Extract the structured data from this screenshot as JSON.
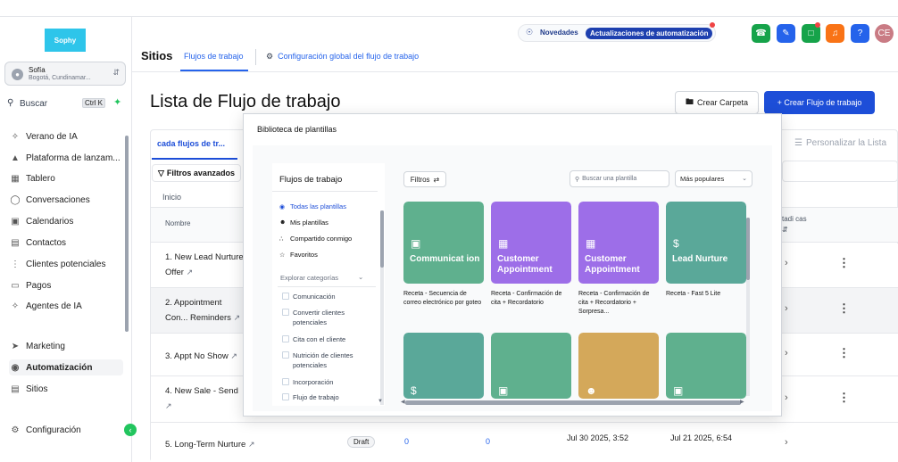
{
  "brand": {
    "logo_text": "Sophy",
    "accent": "#2563eb"
  },
  "location": {
    "name": "Sofía",
    "address": "Bogotá, Cundinamar..."
  },
  "search": {
    "label": "Buscar",
    "shortcut": "Ctrl K"
  },
  "nav": [
    {
      "label": "Verano de IA",
      "icon": "sparkle-icon"
    },
    {
      "label": "Plataforma de lanzam...",
      "icon": "rocket-icon"
    },
    {
      "label": "Tablero",
      "icon": "dashboard-icon"
    },
    {
      "label": "Conversaciones",
      "icon": "chat-icon"
    },
    {
      "label": "Calendarios",
      "icon": "calendar-icon"
    },
    {
      "label": "Contactos",
      "icon": "contacts-icon"
    },
    {
      "label": "Clientes potenciales",
      "icon": "funnel-icon"
    },
    {
      "label": "Pagos",
      "icon": "payments-icon"
    },
    {
      "label": "Agentes de IA",
      "icon": "sparkle-icon"
    },
    {
      "label": "Marketing",
      "icon": "send-icon"
    },
    {
      "label": "Automatización",
      "icon": "automation-icon"
    },
    {
      "label": "Sitios",
      "icon": "sites-icon"
    },
    {
      "label": "Configuración",
      "icon": "gear-icon"
    }
  ],
  "header": {
    "section": "Sitios",
    "tabs": [
      "Flujos de trabajo",
      "Configuración global del flujo de trabajo"
    ],
    "novedades": "Novedades",
    "update_badge": "Actualizaciones de automatización",
    "user_initials": "CE",
    "help": "?"
  },
  "main": {
    "title": "Lista de Flujo de trabajo",
    "btn_folder": "Crear Carpeta",
    "btn_create": "+ Crear Flujo de trabajo",
    "filter_tab": "cada flujos de tr...",
    "personalize": "Personalizar la Lista",
    "advanced_filters": "Filtros avanzados",
    "breadcrumb": "Inicio",
    "col_name": "Nombre",
    "col_status": "tadi cas",
    "rows": [
      {
        "name": "1. New Lead Nurture Offer"
      },
      {
        "name": "2. Appointment Con... Reminders"
      },
      {
        "name": "3. Appt No Show"
      },
      {
        "name": "4. New Sale - Send"
      },
      {
        "name": "5. Long-Term Nurture",
        "status": "Draft",
        "c1": "0",
        "c2": "0",
        "updated": "Jul 30 2025, 3:52",
        "created": "Jul 21 2025, 6:54"
      }
    ]
  },
  "modal": {
    "title": "Biblioteca de plantillas",
    "left_heading": "Flujos de trabajo",
    "menu": [
      "Todas las plantillas",
      "Mis plantillas",
      "Compartido conmigo",
      "Favoritos"
    ],
    "explore": "Explorar categorías",
    "categories": [
      "Comunicación",
      "Convertir clientes potenciales",
      "Cita con el cliente",
      "Nutrición de clientes potenciales",
      "Incorporación",
      "Flujo de trabajo"
    ],
    "filters_btn": "Filtros",
    "search_placeholder": "Buscar una plantilla",
    "sort": "Más populares",
    "cards": [
      {
        "title": "Communicat ion",
        "desc": "Receta - Secuencia de correo electrónico por goteo",
        "color": "#5fb08e",
        "icon": "chat-icon"
      },
      {
        "title": "Customer Appointment",
        "desc": "Receta - Confirmación de cita + Recordatorio",
        "color": "#9d6ee8",
        "icon": "calendar-icon"
      },
      {
        "title": "Customer Appointment",
        "desc": "Receta - Confirmación de cita + Recordatorio + Sorpresa...",
        "color": "#9d6ee8",
        "icon": "calendar-icon"
      },
      {
        "title": "Lead Nurture",
        "desc": "Receta - Fast 5 Lite",
        "color": "#5aa899",
        "icon": "dollar-icon"
      },
      {
        "title": "",
        "desc": "",
        "color": "#5aa899",
        "icon": "dollar-icon"
      },
      {
        "title": "",
        "desc": "",
        "color": "#5fb08e",
        "icon": "chat-icon"
      },
      {
        "title": "",
        "desc": "",
        "color": "#d4a85a",
        "icon": "person-icon"
      },
      {
        "title": "",
        "desc": "",
        "color": "#5fb08e",
        "icon": "chat-icon"
      }
    ]
  }
}
